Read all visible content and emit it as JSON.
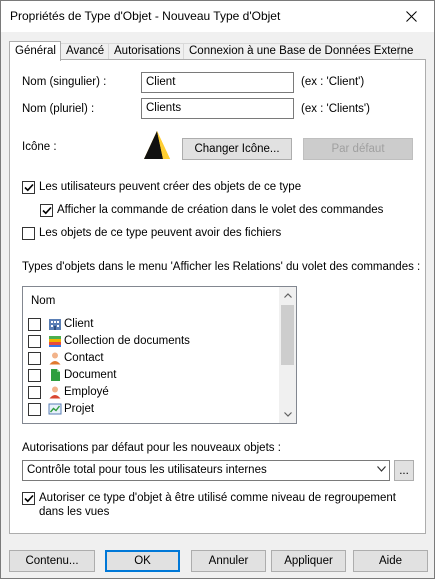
{
  "window": {
    "title": "Propriétés de Type d'Objet - Nouveau Type d'Objet"
  },
  "tabs": [
    {
      "label": "Général"
    },
    {
      "label": "Avancé"
    },
    {
      "label": "Autorisations"
    },
    {
      "label": "Connexion à une Base de Données Externe"
    }
  ],
  "general": {
    "name_singular_label": "Nom (singulier) :",
    "name_singular_value": "Client",
    "name_singular_hint": "(ex : 'Client')",
    "name_plural_label": "Nom (pluriel) :",
    "name_plural_value": "Clients",
    "name_plural_hint": "(ex : 'Clients')",
    "icon_label": "Icône :",
    "change_icon_button": "Changer Icône...",
    "default_button": "Par défaut",
    "can_create_label": "Les utilisateurs peuvent créer des objets de ce type",
    "show_create_command_label": "Afficher la commande de création dans le volet des commandes",
    "can_have_files_label": "Les objets de ce type peuvent avoir des fichiers",
    "relations_label": "Types d'objets dans le menu 'Afficher les Relations' du volet des commandes :",
    "list_header": "Nom",
    "object_types": [
      {
        "label": "Client",
        "icon": "building-icon"
      },
      {
        "label": "Collection de documents",
        "icon": "document-collection-icon"
      },
      {
        "label": "Contact",
        "icon": "contact-person-icon"
      },
      {
        "label": "Document",
        "icon": "document-icon"
      },
      {
        "label": "Employé",
        "icon": "employee-icon"
      },
      {
        "label": "Projet",
        "icon": "project-chart-icon"
      }
    ],
    "default_permissions_label": "Autorisations par défaut pour les nouveaux objets :",
    "default_permissions_value": "Contrôle total pour tous les utilisateurs internes",
    "browse_button": "...",
    "grouping_label": "Autoriser ce type d'objet à être utilisé comme niveau de regroupement dans les vues"
  },
  "footer": {
    "contents_button": "Contenu...",
    "ok_button": "OK",
    "cancel_button": "Annuler",
    "apply_button": "Appliquer",
    "help_button": "Aide"
  },
  "colors": {
    "accent": "#0078d7",
    "window_bg": "#f0f0f0",
    "panel_bg": "#ffffff"
  }
}
